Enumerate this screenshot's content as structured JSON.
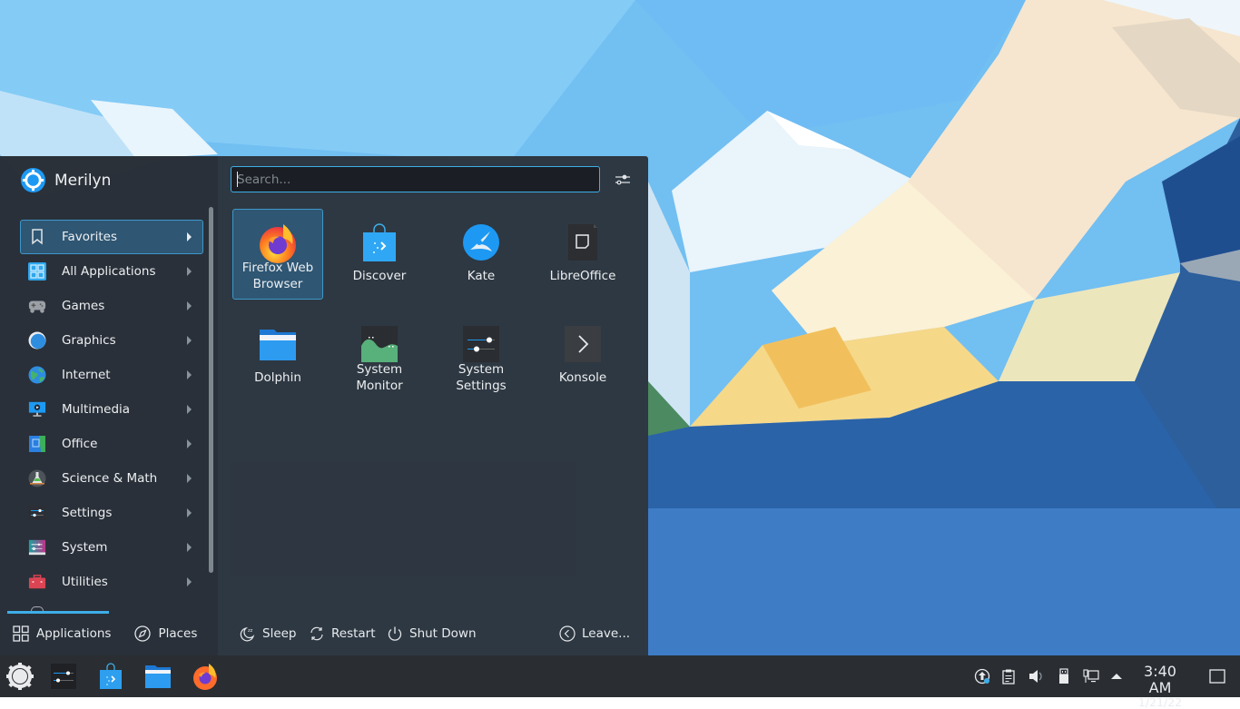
{
  "launcher": {
    "user_name": "Merilyn",
    "search_placeholder": "Search...",
    "categories": [
      {
        "label": "Favorites",
        "icon": "bookmark-icon",
        "active": true
      },
      {
        "label": "All Applications",
        "icon": "grid-icon"
      },
      {
        "label": "Games",
        "icon": "gamepad-icon"
      },
      {
        "label": "Graphics",
        "icon": "graphics-icon"
      },
      {
        "label": "Internet",
        "icon": "globe-icon"
      },
      {
        "label": "Multimedia",
        "icon": "multimedia-icon"
      },
      {
        "label": "Office",
        "icon": "office-icon"
      },
      {
        "label": "Science & Math",
        "icon": "flask-icon"
      },
      {
        "label": "Settings",
        "icon": "settings-sliders-icon"
      },
      {
        "label": "System",
        "icon": "system-icon"
      },
      {
        "label": "Utilities",
        "icon": "toolbox-icon"
      }
    ],
    "favorites": [
      {
        "label": "Firefox Web Browser",
        "icon": "firefox-icon",
        "active": true
      },
      {
        "label": "Discover",
        "icon": "discover-icon"
      },
      {
        "label": "Kate",
        "icon": "kate-icon"
      },
      {
        "label": "LibreOffice",
        "icon": "libreoffice-icon"
      },
      {
        "label": "Dolphin",
        "icon": "dolphin-folder-icon"
      },
      {
        "label": "System Monitor",
        "icon": "system-monitor-icon"
      },
      {
        "label": "System Settings",
        "icon": "system-settings-icon"
      },
      {
        "label": "Konsole",
        "icon": "konsole-icon"
      }
    ],
    "bottom_tabs": [
      {
        "label": "Applications",
        "active": true
      },
      {
        "label": "Places"
      }
    ],
    "power": {
      "sleep": "Sleep",
      "restart": "Restart",
      "shutdown": "Shut Down",
      "leave": "Leave..."
    }
  },
  "taskbar": {
    "pinned": [
      "application-launcher",
      "System Settings",
      "Discover",
      "Dolphin",
      "Firefox Web Browser"
    ],
    "tray": [
      "update-notifier",
      "clipboard",
      "volume",
      "removable-devices",
      "network",
      "expand-tray"
    ],
    "clock": {
      "time": "3:40 AM",
      "date": "1/21/22"
    }
  },
  "colors": {
    "accent": "#3daee9",
    "panel": "#2a2e33",
    "menu_bg": "#2a3038"
  }
}
